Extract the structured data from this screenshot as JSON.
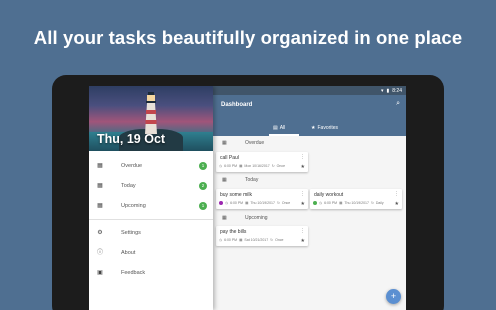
{
  "headline": "All your tasks beautifully organized in one place",
  "statusbar": {
    "time": "8:24"
  },
  "drawer": {
    "date": "Thu, 19 Oct",
    "items": [
      {
        "label": "Overdue",
        "badge": "1",
        "icon": "overdue-icon"
      },
      {
        "label": "Today",
        "badge": "2",
        "icon": "today-icon"
      },
      {
        "label": "Upcoming",
        "badge": "1",
        "icon": "upcoming-icon"
      }
    ],
    "secondary": [
      {
        "label": "Settings",
        "icon": "gear-icon"
      },
      {
        "label": "About",
        "icon": "info-icon"
      },
      {
        "label": "Feedback",
        "icon": "feedback-icon"
      }
    ]
  },
  "appbar": {
    "title": "Dashboard"
  },
  "tabs": [
    {
      "label": "All",
      "icon": "list-icon"
    },
    {
      "label": "Favorites",
      "icon": "star-icon"
    }
  ],
  "sections": {
    "overdue": "Overdue",
    "today": "Today",
    "upcoming": "Upcoming"
  },
  "cards": {
    "call_paul": {
      "title": "call Paul",
      "time": "6:00 PM",
      "date": "Mon 10/16/2017",
      "repeat": "Once"
    },
    "milk": {
      "title": "buy some milk",
      "time": "6:00 PM",
      "date": "Thu 10/19/2017",
      "repeat": "Once",
      "color": "#9c27b0"
    },
    "workout": {
      "title": "daily workout",
      "time": "6:00 PM",
      "date": "Thu 10/19/2017",
      "repeat": "Daily",
      "color": "#4caf50"
    },
    "bills": {
      "title": "pay the bills",
      "time": "6:00 PM",
      "date": "Sat 10/21/2017",
      "repeat": "Once"
    }
  },
  "colors": {
    "background": "#4f6f91",
    "accent": "#5b8fd1",
    "badge": "#4caf50"
  }
}
